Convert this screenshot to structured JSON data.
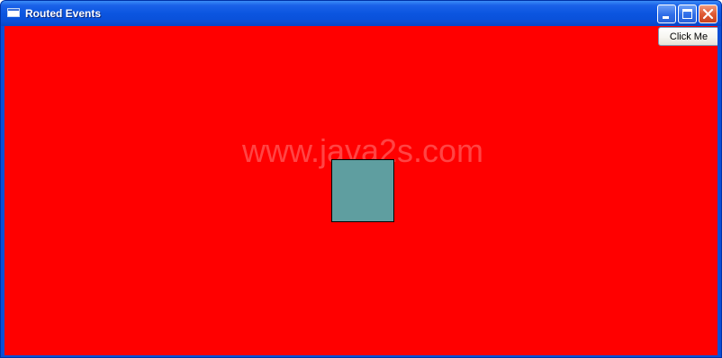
{
  "window": {
    "title": "Routed Events",
    "icon": "window-icon",
    "controls": {
      "minimize": "minimize-icon",
      "maximize": "maximize-icon",
      "close": "close-icon"
    }
  },
  "content": {
    "background_color": "#ff0000",
    "button_label": "Click Me",
    "watermark": "www.java2s.com",
    "square_color": "#5f9ea0"
  }
}
